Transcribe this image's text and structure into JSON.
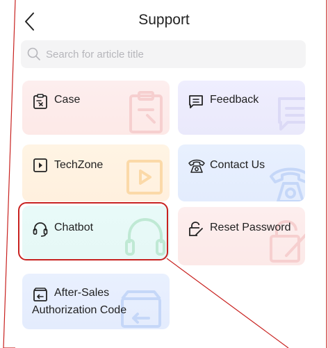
{
  "header": {
    "title": "Support",
    "back_icon": "chevron-left-icon"
  },
  "search": {
    "placeholder": "Search for article title",
    "icon": "search-icon"
  },
  "cards": {
    "case": {
      "label": "Case",
      "icon": "clipboard-icon"
    },
    "feedback": {
      "label": "Feedback",
      "icon": "message-icon"
    },
    "techzone": {
      "label": "TechZone",
      "icon": "play-icon"
    },
    "contact": {
      "label": "Contact Us",
      "icon": "telephone-icon"
    },
    "chatbot": {
      "label": "Chatbot",
      "icon": "headset-icon"
    },
    "reset": {
      "label": "Reset Password",
      "icon": "lock-edit-icon"
    },
    "aftersales": {
      "label_line1": "After-Sales",
      "label_line2": "Authorization Code",
      "icon": "return-box-icon"
    }
  },
  "annotation": {
    "highlight_color": "#c8211f",
    "highlighted_item": "Chatbot"
  }
}
